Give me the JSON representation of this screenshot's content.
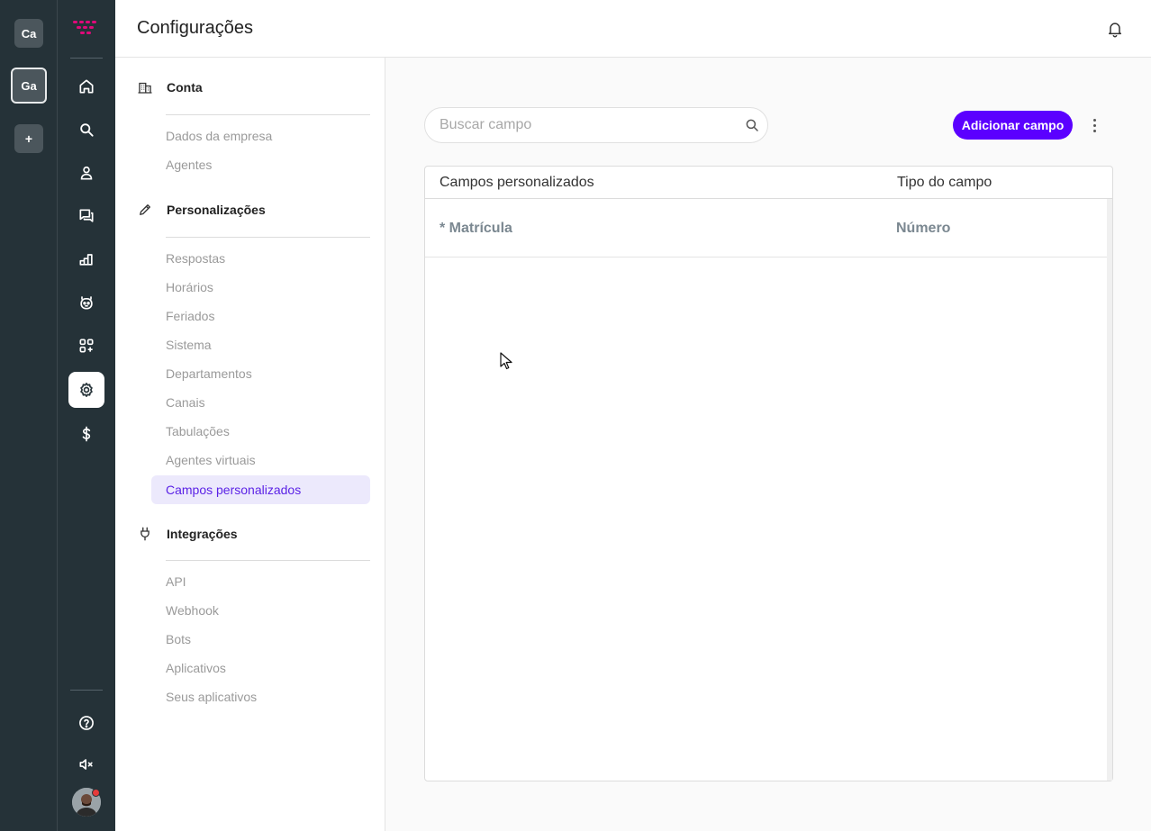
{
  "workspaces": [
    {
      "label": "Ca"
    },
    {
      "label": "Ga"
    },
    {
      "label": "+"
    }
  ],
  "nav_icons": [
    "home-icon",
    "search-icon",
    "contacts-icon",
    "chat-icon",
    "reports-icon",
    "bot-icon",
    "apps-icon",
    "settings-icon",
    "billing-icon"
  ],
  "nav_bottom_icons": [
    "help-icon",
    "mute-icon",
    "avatar"
  ],
  "header": {
    "title": "Configurações"
  },
  "settings_nav": {
    "sections": [
      {
        "label": "Conta",
        "icon": "building-icon",
        "items": [
          "Dados da empresa",
          "Agentes"
        ]
      },
      {
        "label": "Personalizações",
        "icon": "pencil-icon",
        "items": [
          "Respostas",
          "Horários",
          "Feriados",
          "Sistema",
          "Departamentos",
          "Canais",
          "Tabulações",
          "Agentes virtuais",
          "Campos personalizados"
        ]
      },
      {
        "label": "Integrações",
        "icon": "plug-icon",
        "items": [
          "API",
          "Webhook",
          "Bots",
          "Aplicativos",
          "Seus aplicativos"
        ]
      }
    ],
    "active_item": "Campos personalizados"
  },
  "toolbar": {
    "search_placeholder": "Buscar campo",
    "add_button_label": "Adicionar campo"
  },
  "table": {
    "columns": [
      "Campos personalizados",
      "Tipo do campo"
    ],
    "rows": [
      {
        "field": "* Matrícula",
        "type": "Número"
      }
    ]
  },
  "colors": {
    "rail_bg": "#253238",
    "accent": "#5b00ff",
    "active_item_bg": "#ece9fc",
    "active_item_text": "#5b22e6",
    "logo": "#e0097a"
  }
}
